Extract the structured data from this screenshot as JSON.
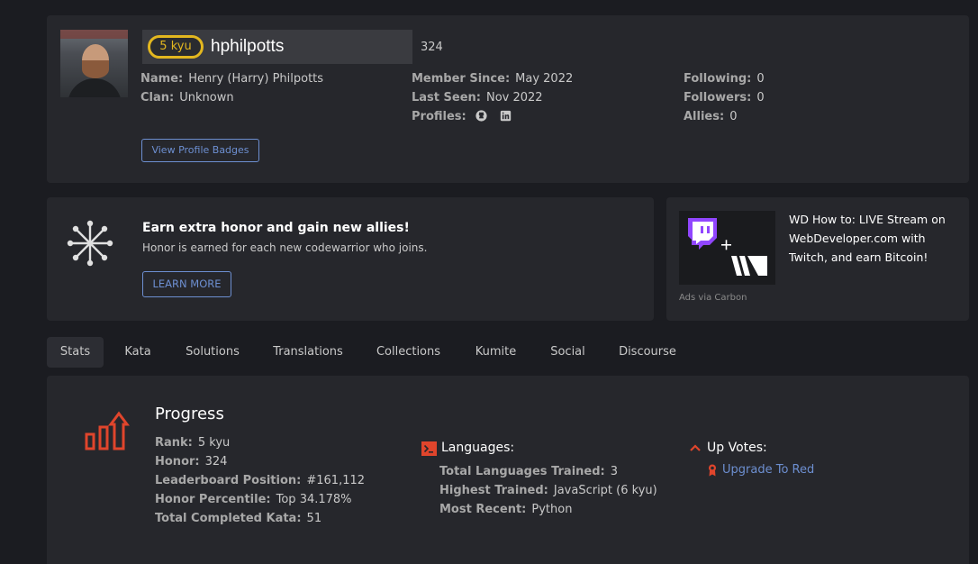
{
  "profile": {
    "rank_badge": "5 kyu",
    "username": "hphilpotts",
    "honor": "324",
    "col1": [
      {
        "label": "Name:",
        "value": "Henry (Harry) Philpotts"
      },
      {
        "label": "Clan:",
        "value": "Unknown"
      }
    ],
    "col2": [
      {
        "label": "Member Since:",
        "value": "May 2022"
      },
      {
        "label": "Last Seen:",
        "value": "Nov 2022"
      },
      {
        "label": "Profiles:",
        "value": ""
      }
    ],
    "col3": [
      {
        "label": "Following:",
        "value": "0"
      },
      {
        "label": "Followers:",
        "value": "0"
      },
      {
        "label": "Allies:",
        "value": "0"
      }
    ],
    "profile_icons": [
      "github-icon",
      "linkedin-icon"
    ],
    "view_badges_label": "View Profile Badges"
  },
  "honor_promo": {
    "title": "Earn extra honor and gain new allies!",
    "subtitle": "Honor is earned for each new codewarrior who joins.",
    "button": "LEARN MORE"
  },
  "ad": {
    "text": "WD How to: LIVE Stream on WebDeveloper.com with Twitch, and earn Bitcoin!",
    "via": "Ads via Carbon"
  },
  "tabs": [
    "Stats",
    "Kata",
    "Solutions",
    "Translations",
    "Collections",
    "Kumite",
    "Social",
    "Discourse"
  ],
  "active_tab": "Stats",
  "stats": {
    "progress_title": "Progress",
    "progress": [
      {
        "label": "Rank:",
        "value": "5 kyu"
      },
      {
        "label": "Honor:",
        "value": "324"
      },
      {
        "label": "Leaderboard Position:",
        "value": "#161,112"
      },
      {
        "label": "Honor Percentile:",
        "value": "Top 34.178%"
      },
      {
        "label": "Total Completed Kata:",
        "value": "51"
      }
    ],
    "languages_title": "Languages:",
    "languages": [
      {
        "label": "Total Languages Trained:",
        "value": "3"
      },
      {
        "label": "Highest Trained:",
        "value": "JavaScript (6 kyu)"
      },
      {
        "label": "Most Recent:",
        "value": "Python"
      }
    ],
    "upvotes_title": "Up Votes:",
    "upgrade_label": "Upgrade To Red"
  },
  "colors": {
    "background": "#1b1c21",
    "panel": "#26272c",
    "rank_yellow": "#e3b71f",
    "link_blue": "#6d8fd1",
    "accent_red": "#e0452c",
    "twitch_purple": "#9146ff"
  }
}
